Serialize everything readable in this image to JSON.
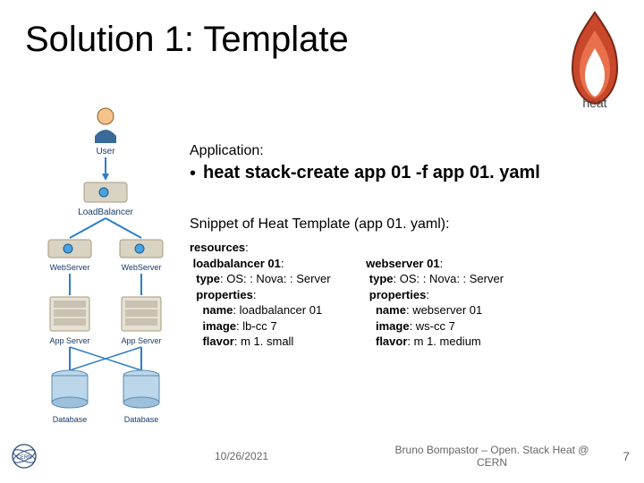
{
  "title": "Solution 1: Template",
  "application_label": "Application:",
  "command": "heat stack-create app 01 -f app 01. yaml",
  "snippet_label": "Snippet of Heat Template (app 01. yaml):",
  "yaml": {
    "resources_key": "resources",
    "left": {
      "name_key": "loadbalancer 01",
      "type_key": "type",
      "type_val": "OS: : Nova: : Server",
      "properties_key": "properties",
      "prop_name_key": "name",
      "prop_name_val": "loadbalancer 01",
      "prop_image_key": "image",
      "prop_image_val": "lb-cc 7",
      "prop_flavor_key": "flavor",
      "prop_flavor_val": "m 1. small"
    },
    "right": {
      "name_key": "webserver 01",
      "type_key": "type",
      "type_val": "OS: : Nova: : Server",
      "properties_key": "properties",
      "prop_name_key": "name",
      "prop_name_val": "webserver 01",
      "prop_image_key": "image",
      "prop_image_val": "ws-cc 7",
      "prop_flavor_key": "flavor",
      "prop_flavor_val": "m 1. medium"
    }
  },
  "diagram": {
    "user": "User",
    "lb": "LoadBalancer",
    "ws": "WebServer",
    "app": "App Server",
    "db": "Database"
  },
  "footer": {
    "date": "10/26/2021",
    "center": "Bruno Bompastor – Open. Stack Heat @ CERN",
    "page": "7"
  }
}
